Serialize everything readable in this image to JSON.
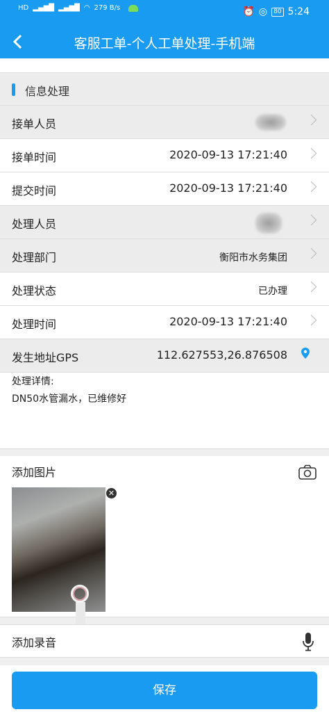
{
  "status_bar": {
    "network_speed": "279 B/s",
    "battery": "80",
    "time": "5:24"
  },
  "header": {
    "title": "客服工单-个人工单处理-手机端"
  },
  "section": {
    "title": "信息处理"
  },
  "rows": [
    {
      "label": "接单人员",
      "value": ""
    },
    {
      "label": "接单时间",
      "value": "2020-09-13 17:21:40"
    },
    {
      "label": "提交时间",
      "value": "2020-09-13 17:21:40"
    },
    {
      "label": "处理人员",
      "value": ""
    },
    {
      "label": "处理部门",
      "value": "衡阳市水务集团"
    },
    {
      "label": "处理状态",
      "value": "已办理"
    },
    {
      "label": "处理时间",
      "value": "2020-09-13 17:21:40"
    },
    {
      "label": "发生地址GPS",
      "value": "112.627553,26.876508"
    }
  ],
  "details": {
    "label": "处理详情:",
    "text": "DN50水管漏水，已维修好"
  },
  "attachments": {
    "image_label": "添加图片",
    "audio_label": "添加录音"
  },
  "footer": {
    "save_label": "保存"
  },
  "colors": {
    "primary": "#1a9bf2"
  }
}
